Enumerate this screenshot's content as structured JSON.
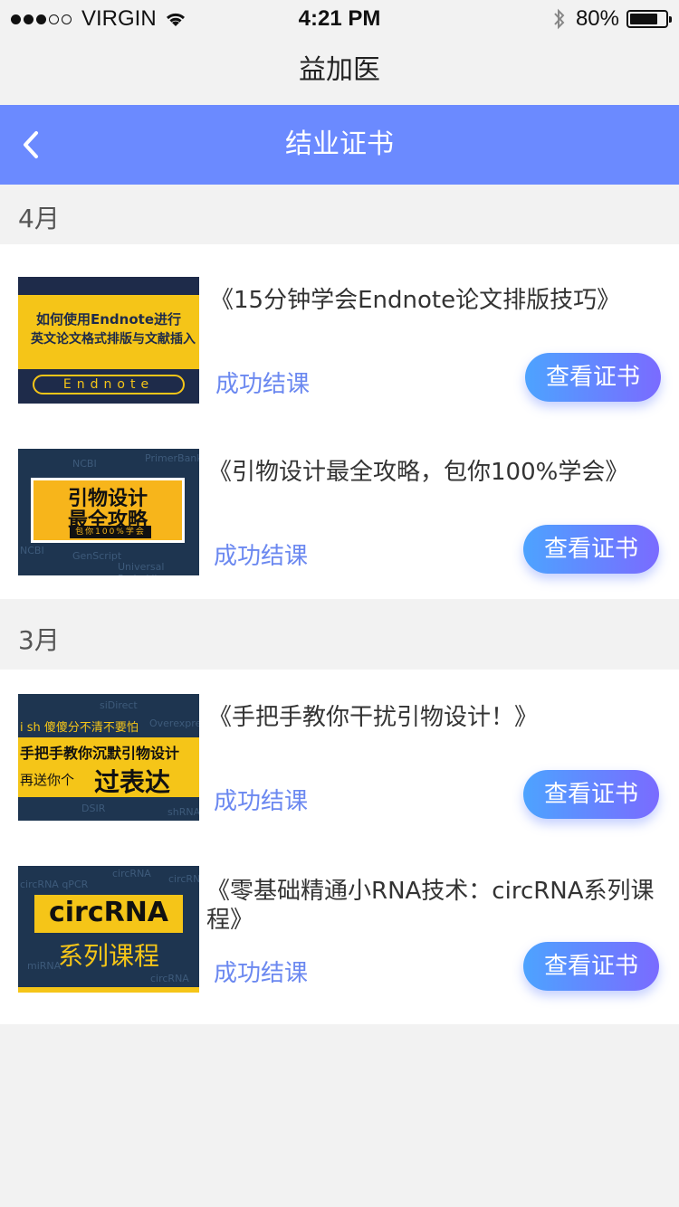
{
  "status_bar": {
    "carrier": "VIRGIN",
    "time": "4:21 PM",
    "battery": "80%"
  },
  "app": {
    "title": "益加医"
  },
  "nav": {
    "title": "结业证书",
    "back_icon": "chevron-left-icon"
  },
  "sections": [
    {
      "month": "4月",
      "items": [
        {
          "title": "《15分钟学会Endnote论文排版技巧》",
          "status": "成功结课",
          "button": "查看证书",
          "thumb": {
            "line1": "如何使用Endnote进行",
            "line2": "英文论文格式排版与文献插入",
            "pill": "Endnote"
          }
        },
        {
          "title": "《引物设计最全攻略，包你100%学会》",
          "status": "成功结课",
          "button": "查看证书",
          "thumb": {
            "line1": "引物设计",
            "line2": "最全攻略",
            "line3": "包你100%学会",
            "bg1": "NCBI",
            "bg2": "PrimerBank",
            "bg3": "GenScript",
            "bg4": "Universal ProbeLibrary",
            "bg5": "NCBI"
          }
        }
      ]
    },
    {
      "month": "3月",
      "items": [
        {
          "title": "《手把手教你干扰引物设计！》",
          "status": "成功结课",
          "button": "查看证书",
          "thumb": {
            "line1": "i sh 傻傻分不清不要怕",
            "line2": "手把手教你沉默引物设计",
            "line3a": "再送你个",
            "line3b": "过表达",
            "bg1": "siDirect",
            "bg2": "Overexpre",
            "bg3": "DSIR",
            "bg4": "shRNA"
          }
        },
        {
          "title": "《零基础精通小RNA技术：circRNA系列课程》",
          "status": "成功结课",
          "button": "查看证书",
          "thumb": {
            "line1": "circRNA",
            "line2": "系列课程",
            "bg1": "circRNA qPCR",
            "bg2": "circRNA",
            "bg3": "circRNA",
            "bg4": "miRNA",
            "bg5": "circRNA"
          }
        }
      ]
    }
  ],
  "colors": {
    "nav_bg": "#6b8aff",
    "accent_text": "#6b88f0",
    "button_from": "#4da3ff",
    "button_to": "#7a6bff"
  }
}
